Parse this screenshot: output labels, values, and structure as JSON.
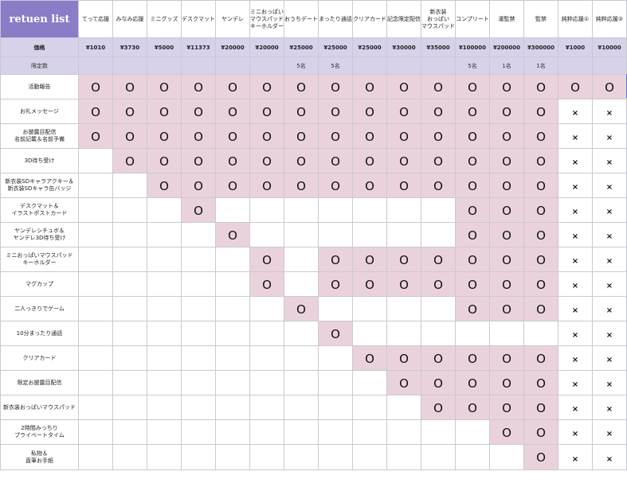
{
  "title": "retuen list",
  "columns": [
    "てって応援",
    "みなみ応援",
    "ミニグッズ",
    "デスクマット",
    "ヤンデレ",
    "ミニおっぱい\nマウスパッド\nキーホルダー",
    "おうちデート",
    "まったり通話",
    "クリアカード",
    "記念限定配信",
    "新衣装\nおっぱい\nマウスパッド",
    "コンプリート",
    "運監禁",
    "監禁",
    "純粋応援①",
    "純粋応援②"
  ],
  "price_label": "価格",
  "prices": [
    "¥1010",
    "¥3730",
    "¥5000",
    "¥11373",
    "¥20000",
    "¥20000",
    "¥25000",
    "¥25000",
    "¥25000",
    "¥30000",
    "¥35000",
    "¥100000",
    "¥200000",
    "¥300000",
    "¥1000",
    "¥10000"
  ],
  "limit_label": "限定数",
  "limits": [
    "",
    "",
    "",
    "",
    "",
    "",
    "5名",
    "5名",
    "",
    "",
    "",
    "5名",
    "1名",
    "1名",
    "",
    ""
  ],
  "marks": {
    "circle": "O",
    "cross": "×"
  },
  "rows": [
    {
      "label": "活動報告",
      "cells": "OOOOOOOOOOOOOOOO"
    },
    {
      "label": "お礼メッセージ",
      "cells": "OOOOOOOOOOOOOOXX"
    },
    {
      "label": "お披露目配信\n名前記載＆名前予備",
      "cells": "OOOOOOOOOOOOOOXX"
    },
    {
      "label": "3D待ち受け",
      "cells": "-OOOOOOOOOOOOOXX"
    },
    {
      "label": "新衣装SDキャラアクキー＆\n新衣装SDキャラ缶バッジ",
      "cells": "--OOOOOOOOOOOOXX"
    },
    {
      "label": "デスクマット＆\nイラストポストカード",
      "cells": "---O-------OOOXX"
    },
    {
      "label": "ヤンデレシチュボ＆\nヤンデレ3D待ち受け",
      "cells": "----O------OOOXX"
    },
    {
      "label": "ミニおっぱいマウスパッド\nキーホルダー",
      "cells": "-----O-OOOOOOOXX"
    },
    {
      "label": "マグカップ",
      "cells": "-----O-OOOOOOOXX"
    },
    {
      "label": "二人っきりでゲーム",
      "cells": "------O----OOOXX"
    },
    {
      "label": "10分まったり通話",
      "cells": "-------O------XX"
    },
    {
      "label": "クリアカード",
      "cells": "--------OOOOOOXX"
    },
    {
      "label": "限定お披露目配信",
      "cells": "---------OOOOOXX"
    },
    {
      "label": "新衣装おっぱいマウスパッド",
      "cells": "----------OOOOXX"
    },
    {
      "label": "2時間みっちり\nプライベートタイム",
      "cells": "------------OOXX"
    },
    {
      "label": "私物＆\n直筆お手紙",
      "cells": "-------------OXX"
    }
  ]
}
